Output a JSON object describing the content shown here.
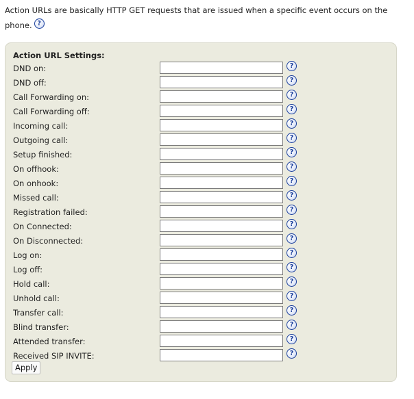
{
  "intro": {
    "text": "Action URLs are basically HTTP GET requests that are issued when a specific event occurs on the phone.",
    "help_glyph": "?"
  },
  "panel": {
    "title": "Action URL Settings:",
    "help_glyph": "?",
    "fields": [
      {
        "label": "DND on:",
        "value": ""
      },
      {
        "label": "DND off:",
        "value": ""
      },
      {
        "label": "Call Forwarding on:",
        "value": ""
      },
      {
        "label": "Call Forwarding off:",
        "value": ""
      },
      {
        "label": "Incoming call:",
        "value": ""
      },
      {
        "label": "Outgoing call:",
        "value": ""
      },
      {
        "label": "Setup finished:",
        "value": ""
      },
      {
        "label": "On offhook:",
        "value": ""
      },
      {
        "label": "On onhook:",
        "value": ""
      },
      {
        "label": "Missed call:",
        "value": ""
      },
      {
        "label": "Registration failed:",
        "value": ""
      },
      {
        "label": "On Connected:",
        "value": ""
      },
      {
        "label": "On Disconnected:",
        "value": ""
      },
      {
        "label": "Log on:",
        "value": ""
      },
      {
        "label": "Log off:",
        "value": ""
      },
      {
        "label": "Hold call:",
        "value": ""
      },
      {
        "label": "Unhold call:",
        "value": ""
      },
      {
        "label": "Transfer call:",
        "value": ""
      },
      {
        "label": "Blind transfer:",
        "value": ""
      },
      {
        "label": "Attended transfer:",
        "value": ""
      },
      {
        "label": "Received SIP INVITE:",
        "value": ""
      }
    ],
    "apply_label": "Apply"
  },
  "colors": {
    "panel_background": "#ebebdf",
    "help_icon": "#1a3f9c"
  }
}
